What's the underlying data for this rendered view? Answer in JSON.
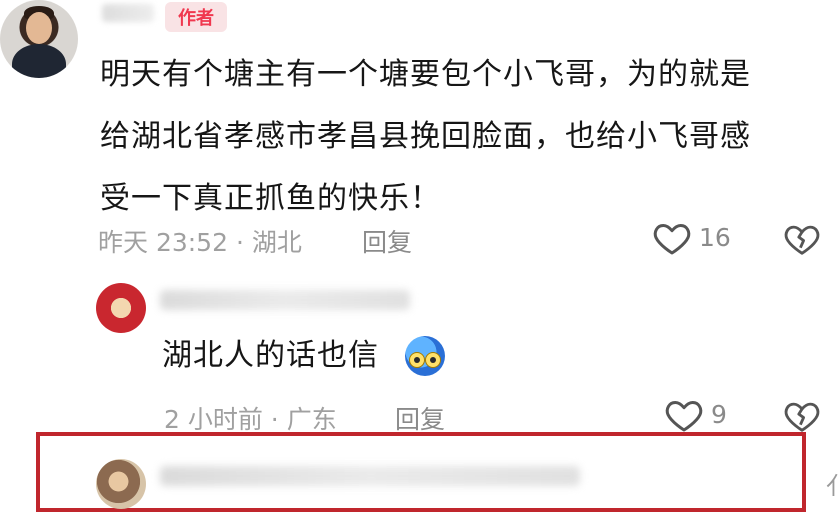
{
  "author_comment": {
    "badge": "作者",
    "lines": [
      "明天有个塘主有一个塘要包个小飞哥，为的就是",
      "给湖北省孝感市孝昌县挽回脸面，也给小飞哥感",
      "受一下真正抓鱼的快乐！"
    ],
    "meta": "昨天 23:52 · 湖北",
    "reply_label": "回复",
    "like_count": "16",
    "icons": [
      "heart-icon",
      "broken-heart-icon"
    ]
  },
  "reply_comment": {
    "text": "湖北人的话也信",
    "emoji": "blue-face-emoji",
    "meta": "2 小时前 · 广东",
    "reply_label": "回复",
    "like_count": "9"
  },
  "edge_glyph": "亻",
  "colors": {
    "badge_text": "#f0384f",
    "badge_bg": "#f9e3e5",
    "meta_gray": "#a0a0a0",
    "highlight_border": "#c0262d"
  }
}
